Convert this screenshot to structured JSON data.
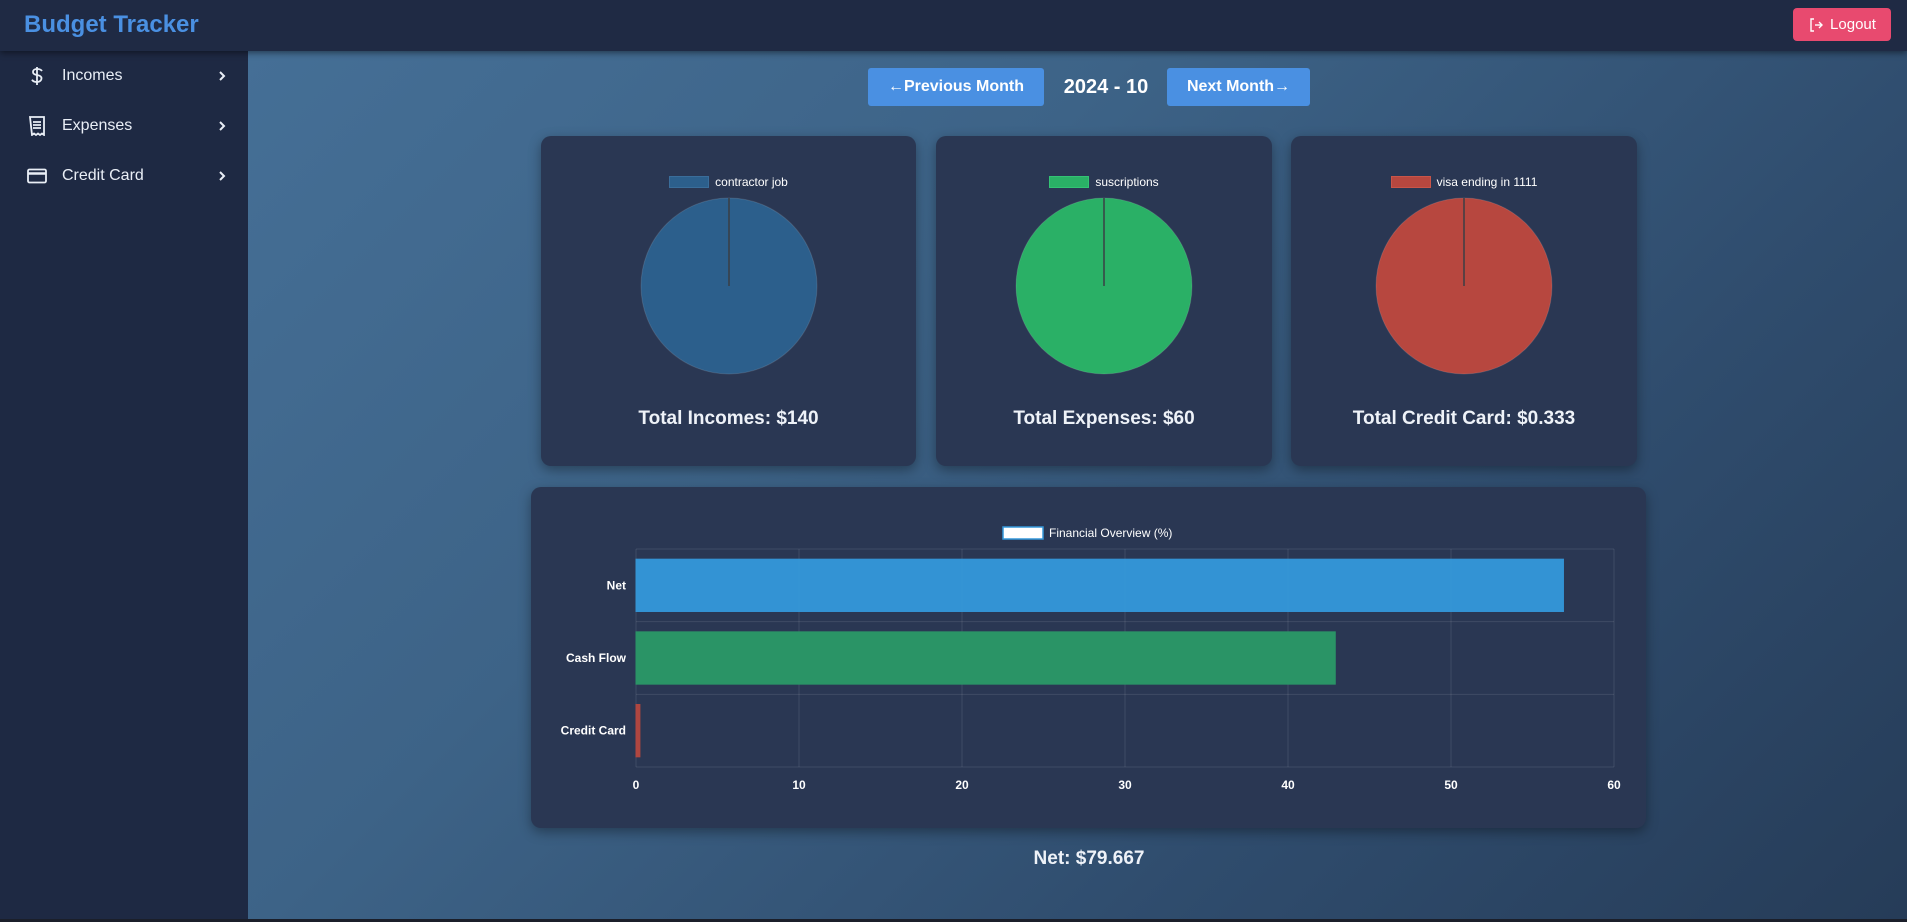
{
  "app": {
    "title": "Budget Tracker",
    "logout_label": "Logout"
  },
  "sidebar": {
    "items": [
      {
        "label": "Incomes",
        "icon": "dollar-icon"
      },
      {
        "label": "Expenses",
        "icon": "receipt-icon"
      },
      {
        "label": "Credit Card",
        "icon": "credit-card-icon"
      }
    ]
  },
  "month_nav": {
    "prev_label": "Previous Month",
    "next_label": "Next Month",
    "current": "2024 - 10"
  },
  "colors": {
    "accent": "#4a90e2",
    "logout": "#e84a6f",
    "income": "#2c5f8c",
    "expense": "#2ab066",
    "credit": "#b7473f"
  },
  "cards": {
    "incomes": {
      "legend": "contractor job",
      "total": "Total Incomes: $140"
    },
    "expenses": {
      "legend": "suscriptions",
      "total": "Total Expenses: $60"
    },
    "credit": {
      "legend": "visa ending in 1111",
      "total": "Total Credit Card: $0.333"
    }
  },
  "net": {
    "total": "Net: $79.667"
  },
  "chart_data": [
    {
      "type": "pie",
      "labels": [
        "contractor job"
      ],
      "values": [
        140
      ],
      "colors": [
        "#2c5f8c"
      ],
      "legend": "top"
    },
    {
      "type": "pie",
      "labels": [
        "suscriptions"
      ],
      "values": [
        60
      ],
      "colors": [
        "#2ab066"
      ],
      "legend": "top"
    },
    {
      "type": "pie",
      "labels": [
        "visa ending in 1111"
      ],
      "values": [
        0.333
      ],
      "colors": [
        "#b7473f"
      ],
      "legend": "top"
    },
    {
      "type": "bar",
      "orientation": "horizontal",
      "categories": [
        "Net",
        "Cash Flow",
        "Credit Card"
      ],
      "series": [
        {
          "name": "Financial Overview (%)",
          "values": [
            56.9,
            42.9,
            0.24
          ],
          "colors": [
            "#3498db",
            "#2a9a68",
            "#b7473f"
          ]
        }
      ],
      "xlim": [
        0,
        60
      ],
      "xticks": [
        0,
        10,
        20,
        30,
        40,
        50,
        60
      ],
      "grid": true,
      "legend": "top"
    }
  ]
}
